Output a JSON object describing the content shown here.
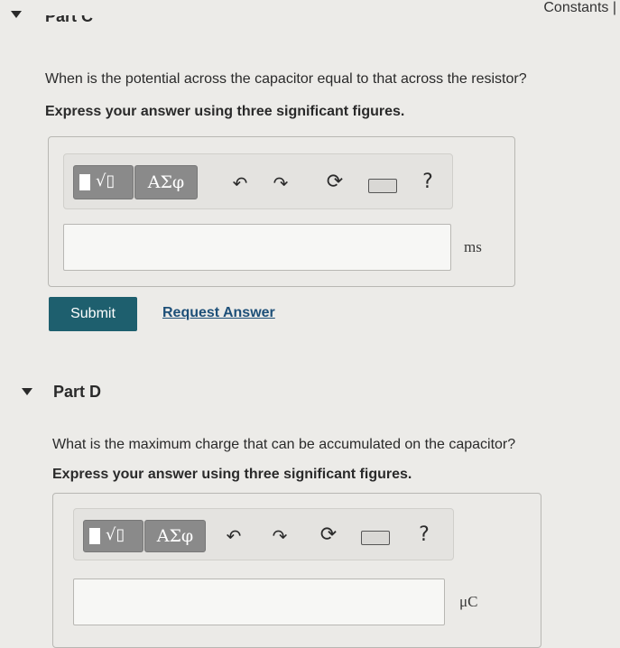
{
  "header": {
    "constants_link": "Constants |"
  },
  "part_c": {
    "title": "Part C",
    "question": "When is the potential across the capacitor equal to that across the resistor?",
    "instruction": "Express your answer using three significant figures.",
    "toolbar": {
      "symbols_label": "ΑΣφ",
      "help_label": "?"
    },
    "input_value": "",
    "unit": "ms",
    "submit_label": "Submit",
    "request_answer_label": "Request Answer"
  },
  "part_d": {
    "title": "Part D",
    "question": "What is the maximum charge that can be accumulated on the capacitor?",
    "instruction": "Express your answer using three significant figures.",
    "toolbar": {
      "symbols_label": "ΑΣφ",
      "help_label": "?"
    },
    "input_value": "",
    "unit": "μC"
  },
  "colors": {
    "accent": "#1e5f6e",
    "link": "#1d4f78",
    "background": "#ecebe8"
  }
}
